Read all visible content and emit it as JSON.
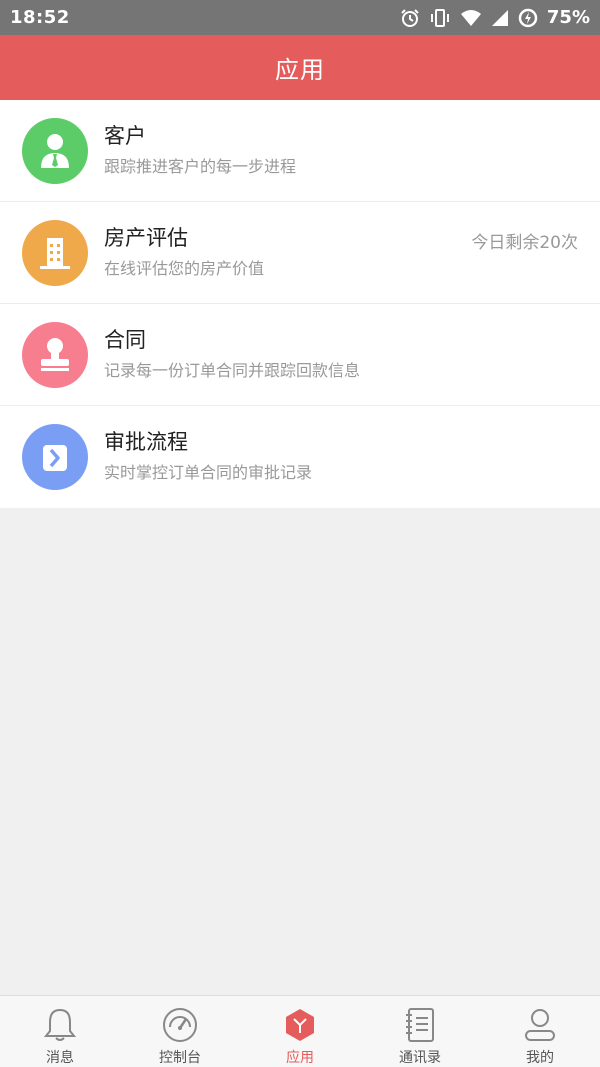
{
  "status_bar": {
    "time": "18:52",
    "battery": "75%",
    "icons": [
      "alarm-icon",
      "vibrate-icon",
      "wifi-icon",
      "signal-icon",
      "battery-charging-icon"
    ]
  },
  "header": {
    "title": "应用"
  },
  "apps": [
    {
      "title": "客户",
      "desc": "跟踪推进客户的每一步进程",
      "extra": "",
      "icon": "customer-icon",
      "color": "#5ccc68"
    },
    {
      "title": "房产评估",
      "desc": "在线评估您的房产价值",
      "extra": "今日剩余20次",
      "icon": "building-icon",
      "color": "#f0a94a"
    },
    {
      "title": "合同",
      "desc": "记录每一份订单合同并跟踪回款信息",
      "extra": "",
      "icon": "stamp-icon",
      "color": "#f77e8f"
    },
    {
      "title": "审批流程",
      "desc": "实时掌控订单合同的审批记录",
      "extra": "",
      "icon": "approval-icon",
      "color": "#7b9ef5"
    }
  ],
  "tabs": [
    {
      "label": "消息",
      "icon": "bell-icon",
      "active": false
    },
    {
      "label": "控制台",
      "icon": "dashboard-icon",
      "active": false
    },
    {
      "label": "应用",
      "icon": "apps-icon",
      "active": true
    },
    {
      "label": "通讯录",
      "icon": "contacts-book-icon",
      "active": false
    },
    {
      "label": "我的",
      "icon": "profile-icon",
      "active": false
    }
  ],
  "colors": {
    "accent": "#e55c5c",
    "status_bar": "#757575"
  }
}
